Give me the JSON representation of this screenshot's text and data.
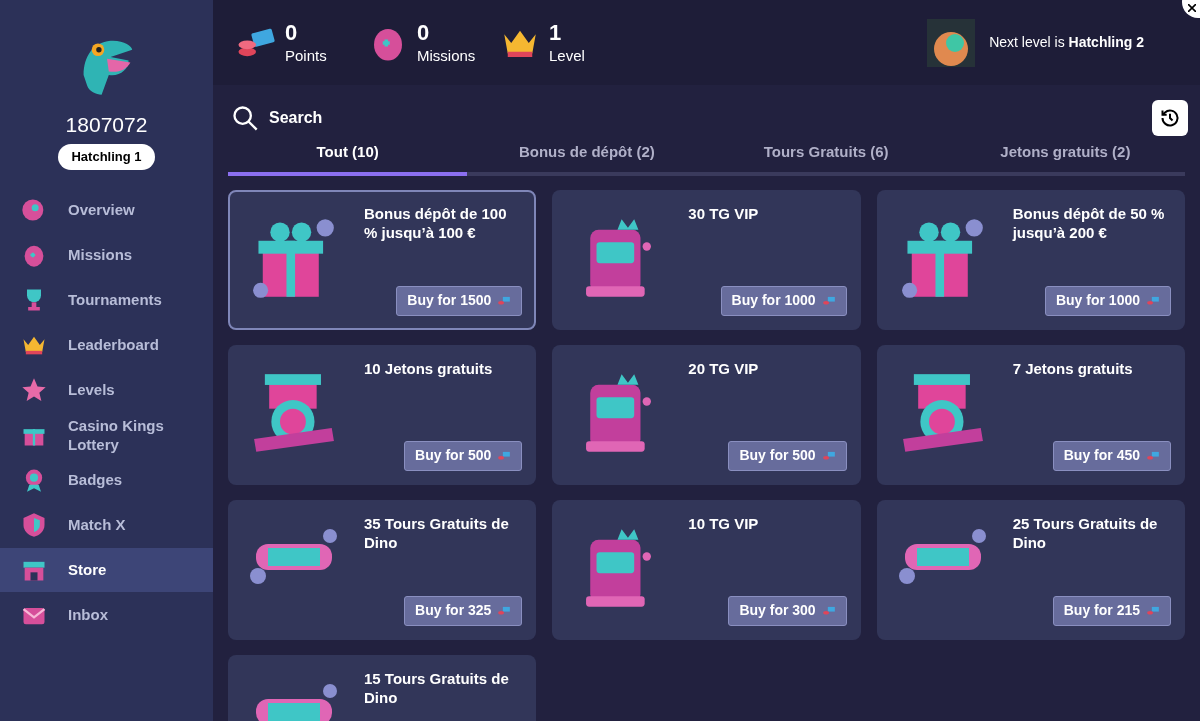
{
  "profile": {
    "id": "1807072",
    "rank": "Hatchling 1"
  },
  "sidebar": {
    "items": [
      {
        "label": "Overview",
        "kind": "dino",
        "selected": false
      },
      {
        "label": "Missions",
        "kind": "egg",
        "selected": false
      },
      {
        "label": "Tournaments",
        "kind": "trophy",
        "selected": false
      },
      {
        "label": "Leaderboard",
        "kind": "crown",
        "selected": false
      },
      {
        "label": "Levels",
        "kind": "star",
        "selected": false
      },
      {
        "label": "Casino Kings Lottery",
        "kind": "gift",
        "selected": false
      },
      {
        "label": "Badges",
        "kind": "medal",
        "selected": false
      },
      {
        "label": "Match X",
        "kind": "shield",
        "selected": false
      },
      {
        "label": "Store",
        "kind": "store",
        "selected": true
      },
      {
        "label": "Inbox",
        "kind": "mail",
        "selected": false
      }
    ]
  },
  "stats": [
    {
      "value": "0",
      "label": "Points",
      "kind": "chips"
    },
    {
      "value": "0",
      "label": "Missions",
      "kind": "egg"
    },
    {
      "value": "1",
      "label": "Level",
      "kind": "crown"
    }
  ],
  "next_level": "Next level is **Hatchling 2**",
  "search": {
    "placeholder": "Search"
  },
  "tabs": [
    {
      "label": "Tout (10)",
      "selected": true
    },
    {
      "label": "Bonus de dépôt (2)",
      "selected": false
    },
    {
      "label": "Tours Gratuits (6)",
      "selected": false
    },
    {
      "label": "Jetons gratuits (2)",
      "selected": false
    }
  ],
  "offers": [
    {
      "title": "Bonus dépôt de 100 % jusqu’à 100 €",
      "button": "Buy for 1500",
      "kind": "gift",
      "selected": true
    },
    {
      "title": "30 TG VIP",
      "button": "Buy for 1000",
      "kind": "slot",
      "selected": false
    },
    {
      "title": "Bonus dépôt de 50 % jusqu’à 200 €",
      "button": "Buy for 1000",
      "kind": "gift",
      "selected": false
    },
    {
      "title": "10 Jetons gratuits",
      "button": "Buy for 500",
      "kind": "chips",
      "selected": false
    },
    {
      "title": "20 TG VIP",
      "button": "Buy for 500",
      "kind": "slot",
      "selected": false
    },
    {
      "title": "7 Jetons gratuits",
      "button": "Buy for 450",
      "kind": "chips",
      "selected": false
    },
    {
      "title": "35 Tours Gratuits de Dino",
      "button": "Buy for 325",
      "kind": "reel",
      "selected": false
    },
    {
      "title": "10 TG VIP",
      "button": "Buy for 300",
      "kind": "slot",
      "selected": false
    },
    {
      "title": "25 Tours Gratuits de Dino",
      "button": "Buy for 215",
      "kind": "reel",
      "selected": false
    },
    {
      "title": "15 Tours Gratuits de Dino",
      "kind": "reel",
      "selected": false
    }
  ]
}
